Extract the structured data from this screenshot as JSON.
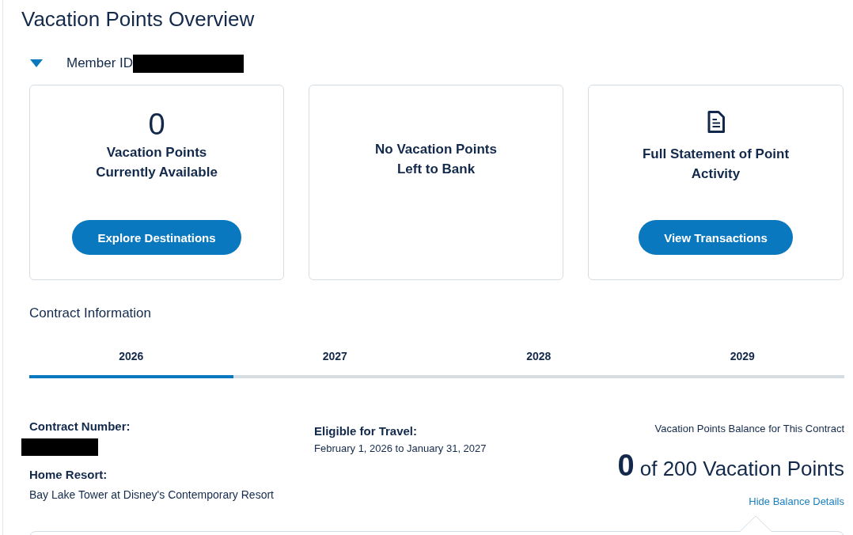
{
  "page": {
    "title": "Vacation Points Overview"
  },
  "member": {
    "label": "Member ID",
    "expanded": true,
    "redacted": true
  },
  "cards": [
    {
      "kind": "count",
      "value": "0",
      "title_lines": [
        "Vacation Points",
        "Currently Available"
      ],
      "button": "Explore Destinations"
    },
    {
      "kind": "message",
      "title_lines": [
        "No Vacation Points",
        "Left to Bank"
      ]
    },
    {
      "kind": "document",
      "title_lines": [
        "Full Statement of Point",
        "Activity"
      ],
      "button": "View Transactions"
    }
  ],
  "contract_information": {
    "heading": "Contract Information",
    "tabs": [
      {
        "label": "2026",
        "selected": true
      },
      {
        "label": "2027",
        "selected": false
      },
      {
        "label": "2028",
        "selected": false
      },
      {
        "label": "2029",
        "selected": false
      }
    ],
    "contract_number": {
      "label": "Contract Number:",
      "redacted": true
    },
    "home_resort": {
      "label": "Home Resort:",
      "value": "Bay Lake Tower at Disney's Contemporary Resort"
    },
    "eligible_for_travel": {
      "label": "Eligible for Travel:",
      "value": "February 1, 2026 to January 31, 2027"
    },
    "balance": {
      "label": "Vacation Points Balance for This Contract",
      "amount": "**0** of 200 Vacation Points",
      "link": "Hide Balance Details",
      "details_expanded": true
    }
  }
}
